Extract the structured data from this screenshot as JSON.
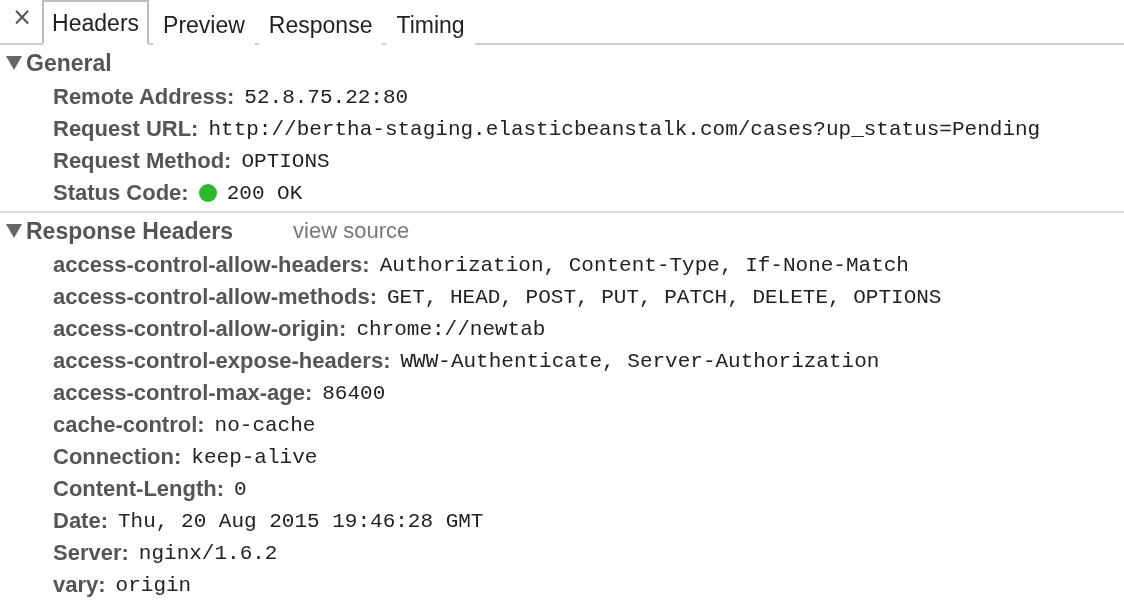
{
  "close_label": "×",
  "tabs": [
    {
      "label": "Headers",
      "selected": true
    },
    {
      "label": "Preview",
      "selected": false
    },
    {
      "label": "Response",
      "selected": false
    },
    {
      "label": "Timing",
      "selected": false
    }
  ],
  "sections": [
    {
      "title": "General",
      "expanded": true,
      "rows": [
        {
          "name": "Remote Address:",
          "value": "52.8.75.22:80"
        },
        {
          "name": "Request URL:",
          "value": "http://bertha-staging.elasticbeanstalk.com/cases?up_status=Pending"
        },
        {
          "name": "Request Method:",
          "value": "OPTIONS"
        },
        {
          "name": "Status Code:",
          "value": "200 OK",
          "color": "#2db82d"
        }
      ]
    },
    {
      "title": "Response Headers",
      "link": "view source",
      "expanded": true,
      "rows": [
        {
          "name": "access-control-allow-headers:",
          "value": "Authorization, Content-Type, If-None-Match"
        },
        {
          "name": "access-control-allow-methods:",
          "value": "GET, HEAD, POST, PUT, PATCH, DELETE, OPTIONS"
        },
        {
          "name": "access-control-allow-origin:",
          "value": "chrome://newtab"
        },
        {
          "name": "access-control-expose-headers:",
          "value": "WWW-Authenticate, Server-Authorization"
        },
        {
          "name": "access-control-max-age:",
          "value": "86400"
        },
        {
          "name": "cache-control:",
          "value": "no-cache"
        },
        {
          "name": "Connection:",
          "value": "keep-alive"
        },
        {
          "name": "Content-Length:",
          "value": "0"
        },
        {
          "name": "Date:",
          "value": "Thu, 20 Aug 2015 19:46:28 GMT"
        },
        {
          "name": "Server:",
          "value": "nginx/1.6.2"
        },
        {
          "name": "vary:",
          "value": "origin"
        }
      ]
    }
  ]
}
